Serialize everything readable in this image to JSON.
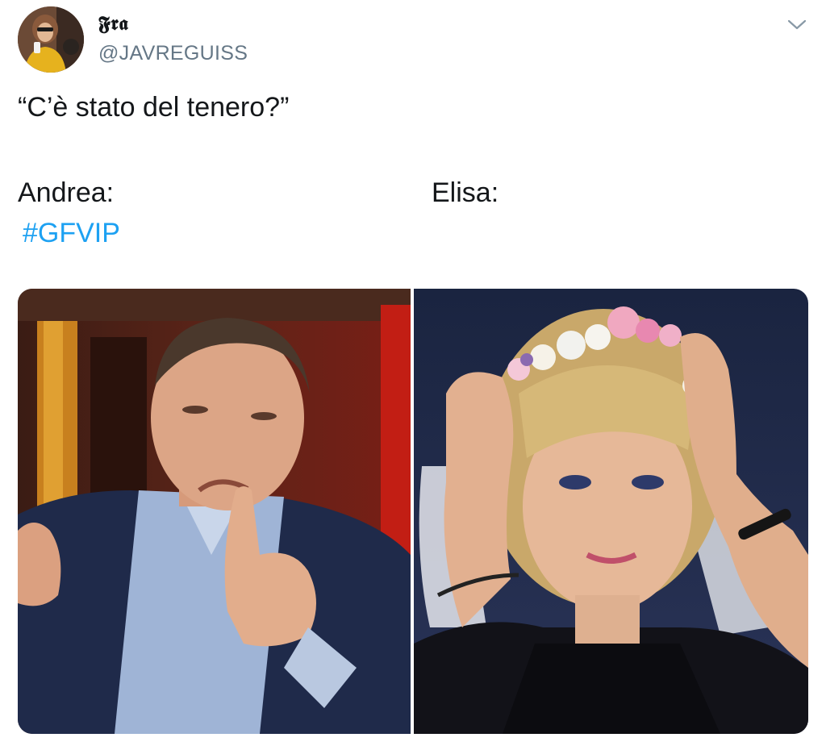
{
  "tweet": {
    "display_name": "𝕱𝖗𝖆",
    "handle": "@JAVREGUISS",
    "caret_icon": "chevron-down-icon",
    "text_quote": "“C’è stato del tenero?”",
    "label_left": "Andrea:",
    "label_right": "Elisa:",
    "hashtag": "#GFVIP"
  },
  "colors": {
    "link": "#1da1f2",
    "secondary_text": "#657786",
    "primary_text": "#14171a"
  }
}
